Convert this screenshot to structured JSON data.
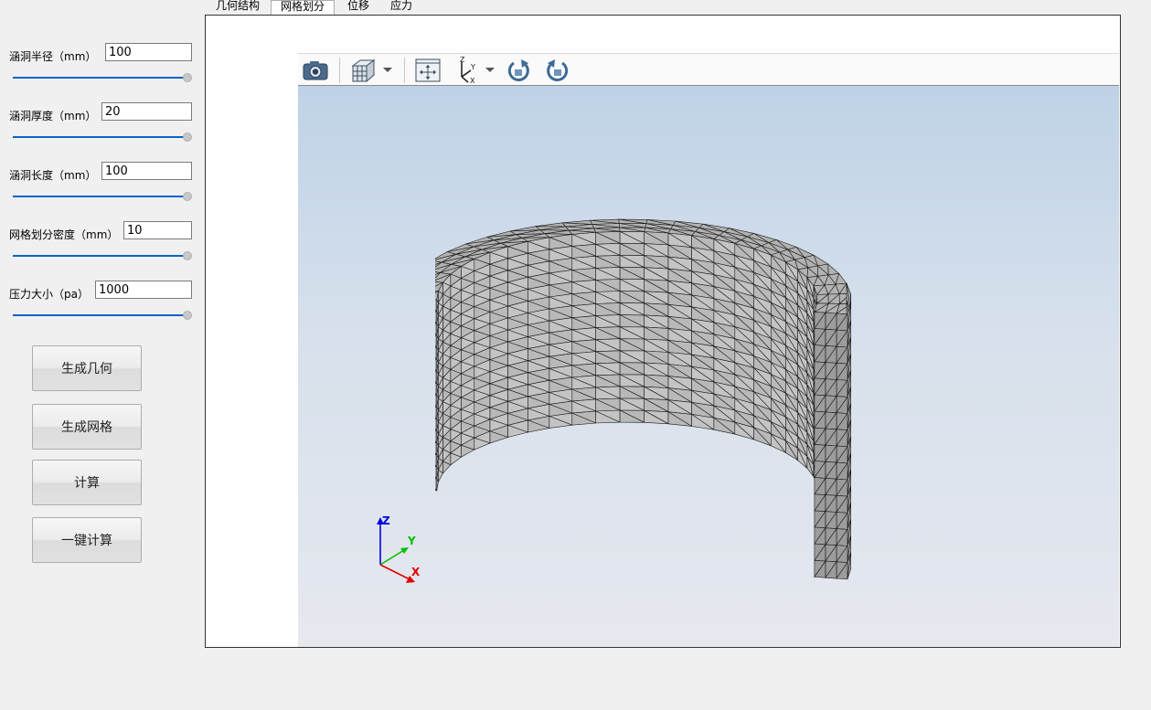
{
  "params": [
    {
      "label": "涵洞半径（mm）",
      "value": "100"
    },
    {
      "label": "涵洞厚度（mm）",
      "value": "20"
    },
    {
      "label": "涵洞长度（mm）",
      "value": "100"
    },
    {
      "label": "网格划分密度（mm）",
      "value": "10"
    },
    {
      "label": "压力大小（pa）",
      "value": "1000"
    }
  ],
  "buttons": {
    "generate_geometry": "生成几何",
    "generate_mesh": "生成网格",
    "compute": "计算",
    "one_click_compute": "一键计算"
  },
  "tabs": [
    {
      "label": "几何结构",
      "active": false
    },
    {
      "label": "网格划分",
      "active": true
    },
    {
      "label": "位移",
      "active": false
    },
    {
      "label": "应力",
      "active": false
    }
  ],
  "viewer": {
    "toolbar_icons": [
      "camera-icon",
      "view-cube-icon",
      "fit-all-icon",
      "axes-orientation-icon",
      "rotate-cw-icon",
      "rotate-ccw-icon"
    ],
    "triad_labels": {
      "z": "Z",
      "y": "Y",
      "x": "X"
    },
    "colors": {
      "mesh_fill": "#a9a9a9",
      "mesh_edge": "#1a1a1a",
      "bg_top": "#bbd0e6",
      "bg_bottom": "#e6e8ee",
      "x_axis": "#e00000",
      "y_axis": "#00c000",
      "z_axis": "#0000e0"
    }
  },
  "colors": {
    "slider_track": "#0a64c8",
    "panel_bg": "#f0f0f0"
  }
}
